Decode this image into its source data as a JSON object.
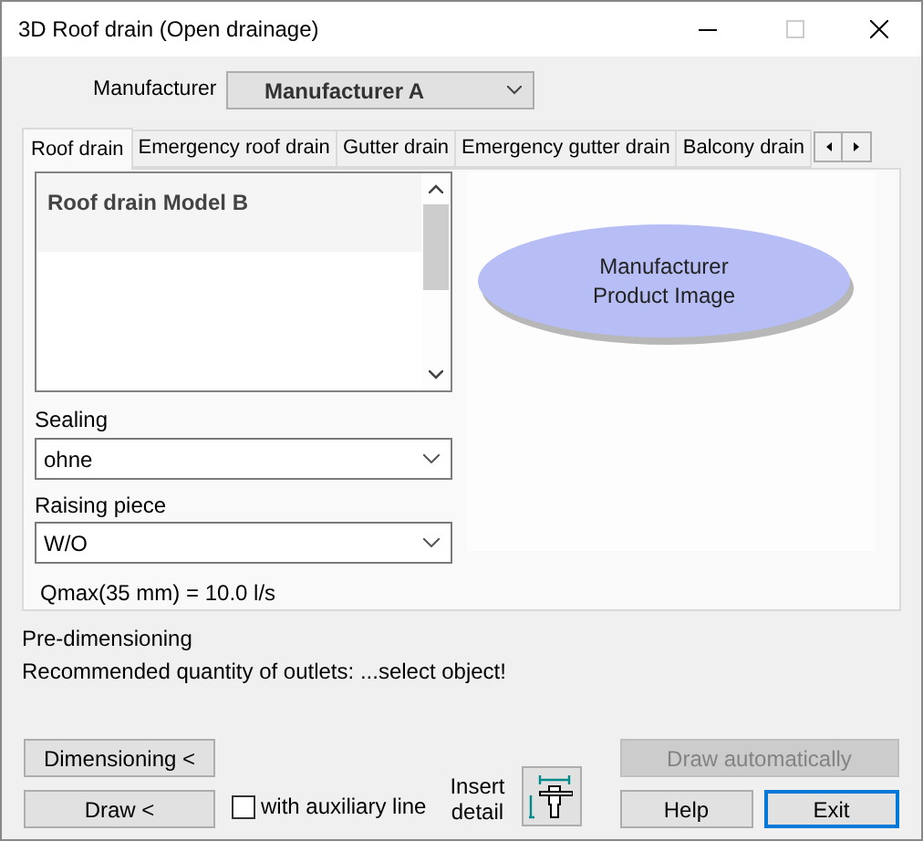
{
  "window": {
    "title": "3D Roof drain (Open drainage)"
  },
  "manufacturer": {
    "label": "Manufacturer",
    "value": "Manufacturer A"
  },
  "tabs": [
    {
      "label": "Roof drain",
      "selected": true
    },
    {
      "label": "Emergency roof drain",
      "selected": false
    },
    {
      "label": "Gutter drain",
      "selected": false
    },
    {
      "label": "Emergency gutter drain",
      "selected": false
    },
    {
      "label": "Balcony drain",
      "selected": false
    }
  ],
  "models": [
    {
      "label": "Roof drain Model B",
      "selected": true
    }
  ],
  "sealing": {
    "label": "Sealing",
    "value": "ohne"
  },
  "raising_piece": {
    "label": "Raising piece",
    "value": "W/O"
  },
  "qmax": "Qmax(35 mm) = 10.0 l/s",
  "product_image": {
    "text": [
      "Manufacturer",
      "Product Image"
    ]
  },
  "pre_dimensioning": {
    "title": "Pre-dimensioning",
    "message": "Recommended quantity of outlets: ...select object!"
  },
  "buttons": {
    "dimensioning": {
      "label": "Dimensioning <"
    },
    "draw": {
      "label": "Draw <"
    },
    "draw_automatically": {
      "label": "Draw automatically",
      "disabled": true
    },
    "help": {
      "label": "Help"
    },
    "exit": {
      "label": "Exit",
      "focused": true
    }
  },
  "auxiliary_line": {
    "label": "with auxiliary line",
    "checked": false
  },
  "insert_detail": {
    "label": [
      "Insert",
      "detail"
    ]
  }
}
